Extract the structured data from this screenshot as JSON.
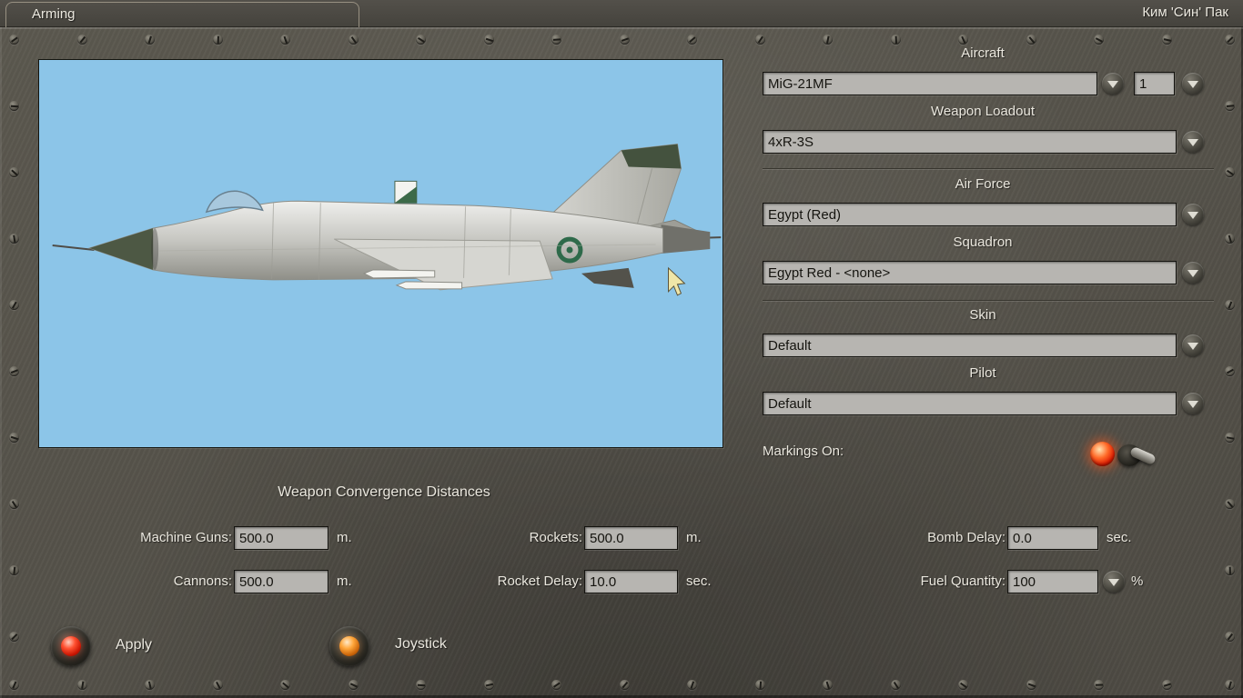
{
  "header": {
    "tab": "Arming",
    "player": "Ким  'Син' Пак"
  },
  "right_panel": {
    "aircraft": {
      "label": "Aircraft",
      "value": "MiG-21MF",
      "count": "1"
    },
    "loadout": {
      "label": "Weapon Loadout",
      "value": "4xR-3S"
    },
    "air_force": {
      "label": "Air Force",
      "value": "Egypt (Red)"
    },
    "squadron": {
      "label": "Squadron",
      "value": "Egypt Red - <none>"
    },
    "skin": {
      "label": "Skin",
      "value": "Default"
    },
    "pilot": {
      "label": "Pilot",
      "value": "Default"
    },
    "markings": {
      "label": "Markings On:"
    }
  },
  "convergence": {
    "title": "Weapon Convergence Distances",
    "machine_guns": {
      "label": "Machine Guns:",
      "value": "500.0",
      "unit": "m."
    },
    "cannons": {
      "label": "Cannons:",
      "value": "500.0",
      "unit": "m."
    },
    "rockets": {
      "label": "Rockets:",
      "value": "500.0",
      "unit": "m."
    },
    "rocket_delay": {
      "label": "Rocket Delay:",
      "value": "10.0",
      "unit": "sec."
    },
    "bomb_delay": {
      "label": "Bomb Delay:",
      "value": "0.0",
      "unit": "sec."
    },
    "fuel_quantity": {
      "label": "Fuel Quantity:",
      "value": "100",
      "unit": "%"
    }
  },
  "actions": {
    "apply": "Apply",
    "joystick": "Joystick"
  },
  "colors": {
    "lamp_red": "#dd1c02",
    "lamp_amber": "#ffa63a",
    "sky": "#8cc5e8"
  }
}
